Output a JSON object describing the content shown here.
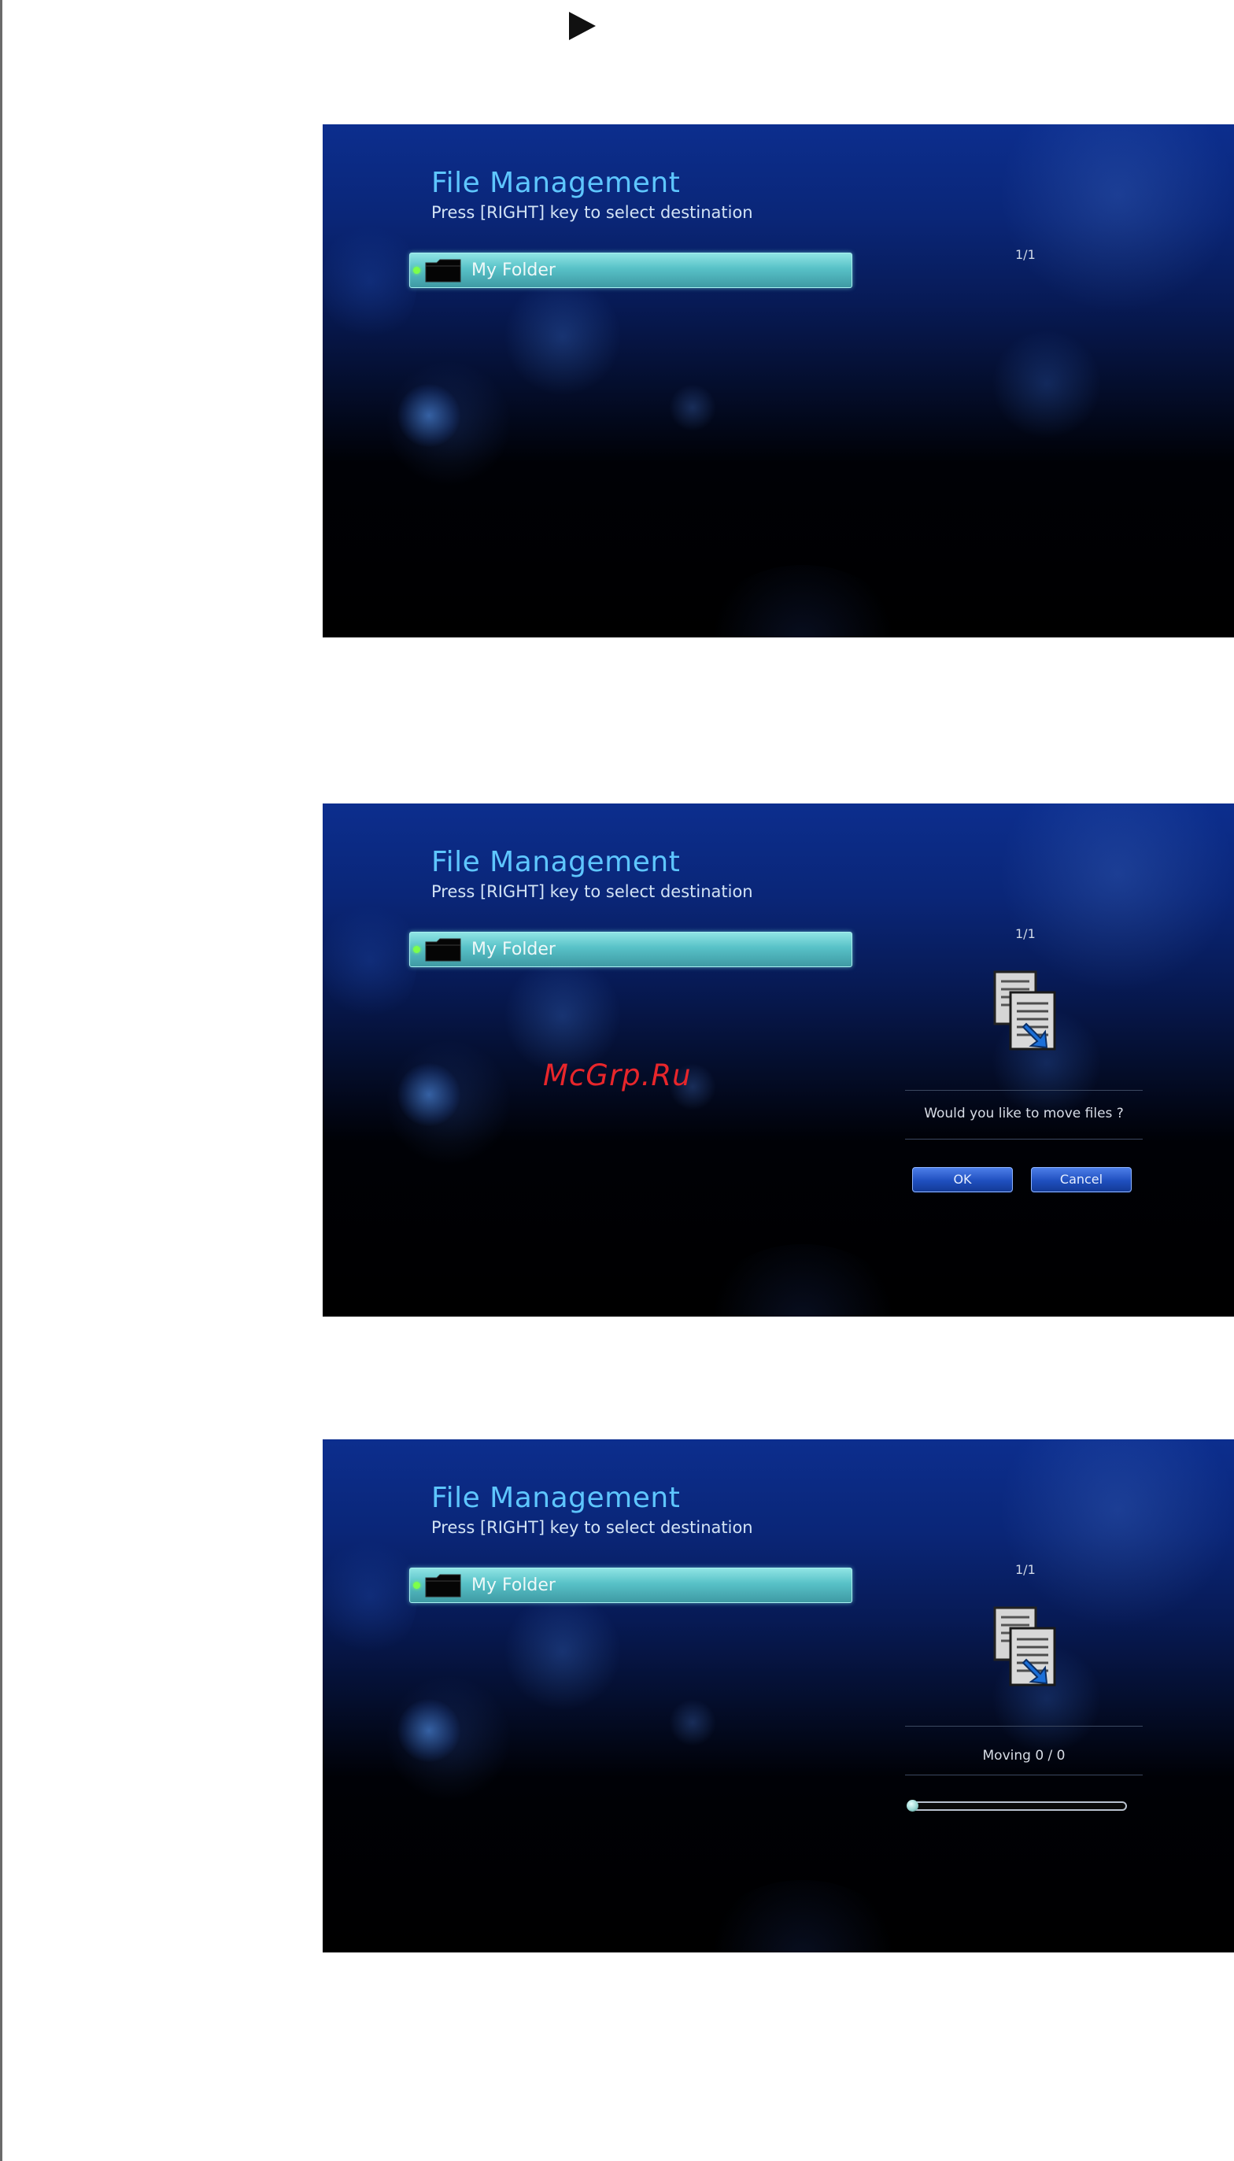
{
  "screens": [
    {
      "title": "File Management",
      "subtitle": "Press [RIGHT] key to select destination",
      "page_count": "1/1",
      "folder_label": "My Folder"
    },
    {
      "title": "File Management",
      "subtitle": "Press [RIGHT] key to select destination",
      "page_count": "1/1",
      "folder_label": "My Folder",
      "dialog": {
        "question": "Would you like to move files ?",
        "ok_label": "OK",
        "cancel_label": "Cancel"
      }
    },
    {
      "title": "File Management",
      "subtitle": "Press [RIGHT] key to select destination",
      "page_count": "1/1",
      "folder_label": "My Folder",
      "progress": {
        "text": "Moving 0 / 0",
        "fraction": 0
      }
    }
  ],
  "watermark": "McGrp.Ru",
  "colors": {
    "title": "#5ec6ff",
    "highlight": "#57c1c7",
    "button": "#1f4fbf",
    "watermark": "#e8262b"
  },
  "icons": [
    "play-icon",
    "folder-icon",
    "move-files-icon"
  ]
}
